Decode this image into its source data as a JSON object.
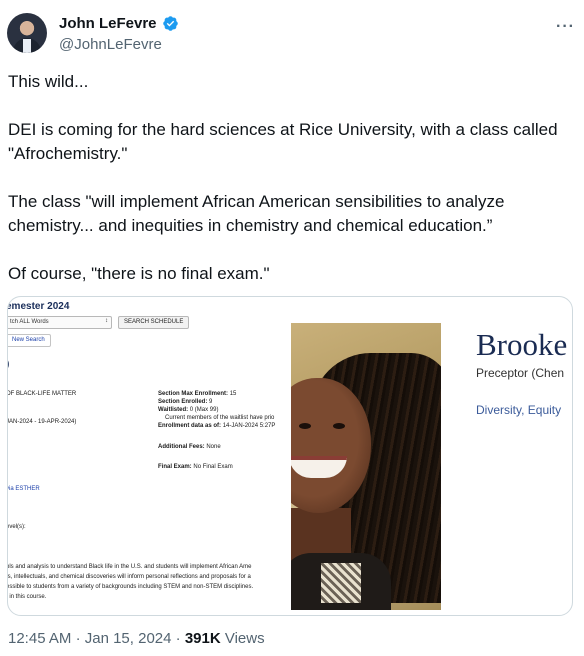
{
  "author": {
    "name": "John LeFevre",
    "handle": "@JohnLeFevre",
    "verified": true,
    "verified_color": "#1d9bf0"
  },
  "more_glyph": "···",
  "tweet": {
    "paragraphs": [
      "This wild...",
      "DEI is coming for the hard sciences at Rice University, with a class called \"Afrochemistry.\"",
      "The class \"will implement African American sensibilities to analyze chemistry... and inequities in chemistry and chemical education.”",
      "Of course, \"there is no final exam.\""
    ]
  },
  "media": {
    "schedule": {
      "semester_title": "emester 2024",
      "select_value": "tch ALL Words",
      "search_button": "SEARCH SCHEDULE",
      "new_search": "New Search",
      "marker": ")",
      "course_title": "OF BLACK-LIFE MATTER",
      "dates": "JAN-2024 - 19-APR-2024)",
      "max_enroll_label": "Section Max Enrollment:",
      "max_enroll_value": "15",
      "enrolled_label": "Section Enrolled:",
      "enrolled_value": "9",
      "waitlisted_label": "Waitlisted:",
      "waitlisted_value": "0 (Max 99)",
      "waitlist_note": "Current members of the waitlist have prio",
      "enroll_data_label": "Enrollment data as of:",
      "enroll_data_value": "14-JAN-2024 5:27P",
      "fees_label": "Additional Fees:",
      "fees_value": "None",
      "exam_label": "Final Exam:",
      "exam_value": "No Final Exam",
      "via": "via ESTHER",
      "levels": "evel(s):",
      "desc_line1": "ols and analysis to understand Black life in the U.S. and students will implement African Ame",
      "desc_line2": "ts, intellectuals, and chemical discoveries will inform personal reflections and proposals for a",
      "desc_line3": "essible to students from a variety of backgrounds including STEM and non-STEM disciplines.",
      "desc_line4": "t in this course."
    },
    "profile": {
      "name": "Brooke",
      "title": "Preceptor (Chen",
      "department": "Diversity, Equity"
    }
  },
  "meta": {
    "time": "12:45 AM",
    "separator": "·",
    "date": "Jan 15, 2024",
    "views_count": "391K",
    "views_label": "Views"
  }
}
